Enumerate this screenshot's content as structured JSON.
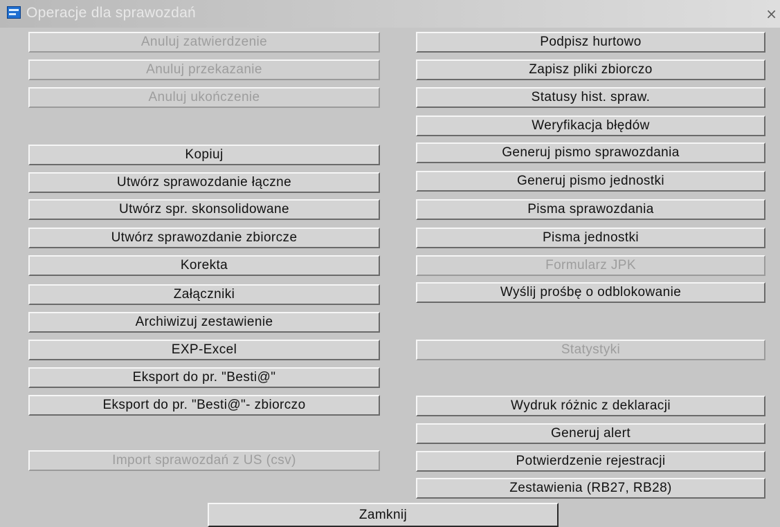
{
  "window": {
    "title": "Operacje dla sprawozdań",
    "close_glyph": "×"
  },
  "left_buttons": {
    "anuluj_zatwierdzenie": "Anuluj zatwierdzenie",
    "anuluj_przekazanie": "Anuluj przekazanie",
    "anuluj_ukonczenie": "Anuluj ukończenie",
    "kopiuj": "Kopiuj",
    "utworz_laczne": "Utwórz sprawozdanie łączne",
    "utworz_skonsolidowane": "Utwórz spr. skonsolidowane",
    "utworz_zbiorcze": "Utwórz sprawozdanie zbiorcze",
    "korekta": "Korekta",
    "zalaczniki": "Załączniki",
    "archiwizuj": "Archiwizuj zestawienie",
    "exp_excel": "EXP-Excel",
    "eksport_besti": "Eksport do pr. \"Besti@\"",
    "eksport_besti_zbiorczo": "Eksport do pr. \"Besti@\"- zbiorczo",
    "import_us": "Import sprawozdań z US (csv)"
  },
  "right_buttons": {
    "podpisz_hurtowo": "Podpisz hurtowo",
    "zapisz_pliki": "Zapisz pliki zbiorczo",
    "statusy_hist": "Statusy hist. spraw.",
    "weryfikacja": "Weryfikacja błędów",
    "generuj_pismo_spr": "Generuj pismo sprawozdania",
    "generuj_pismo_jedn": "Generuj pismo jednostki",
    "pisma_spr": "Pisma sprawozdania",
    "pisma_jedn": "Pisma jednostki",
    "formularz_jpk": "Formularz JPK",
    "wyslij_prosbe": "Wyślij prośbę o odblokowanie",
    "statystyki": "Statystyki",
    "wydruk_roznic": "Wydruk różnic z deklaracji",
    "generuj_alert": "Generuj alert",
    "potwierdzenie": "Potwierdzenie rejestracji",
    "zestawienia": "Zestawienia (RB27, RB28)"
  },
  "footer": {
    "zamknij": "Zamknij"
  }
}
